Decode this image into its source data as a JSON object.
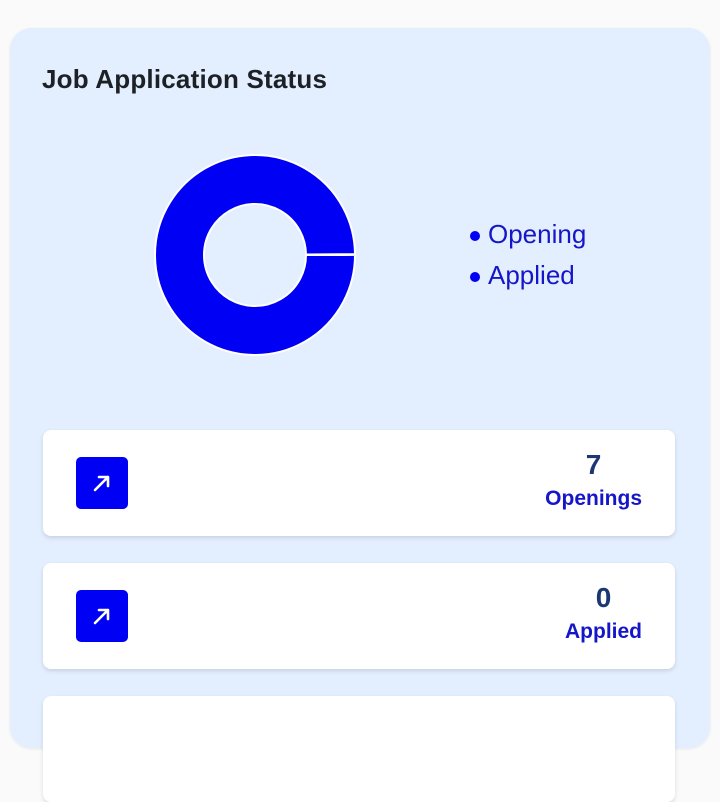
{
  "card": {
    "title": "Job Application Status"
  },
  "chart_data": {
    "type": "pie",
    "style": "donut",
    "categories": [
      "Opening",
      "Applied"
    ],
    "values": [
      7,
      0
    ],
    "colors": [
      "#0000f5",
      "#0000f5"
    ],
    "legend_position": "right"
  },
  "legend": [
    {
      "label": "Opening",
      "color": "#0000f5"
    },
    {
      "label": "Applied",
      "color": "#0000f5"
    }
  ],
  "stats": [
    {
      "value": "7",
      "label": "Openings",
      "icon": "arrow-up-right-icon"
    },
    {
      "value": "0",
      "label": "Applied",
      "icon": "arrow-up-right-icon"
    },
    {
      "value": "",
      "label": "",
      "icon": ""
    }
  ],
  "colors": {
    "accent": "#0000f5",
    "card_background": "#e3eefe",
    "label": "#1616c9",
    "value": "#1c3772"
  }
}
